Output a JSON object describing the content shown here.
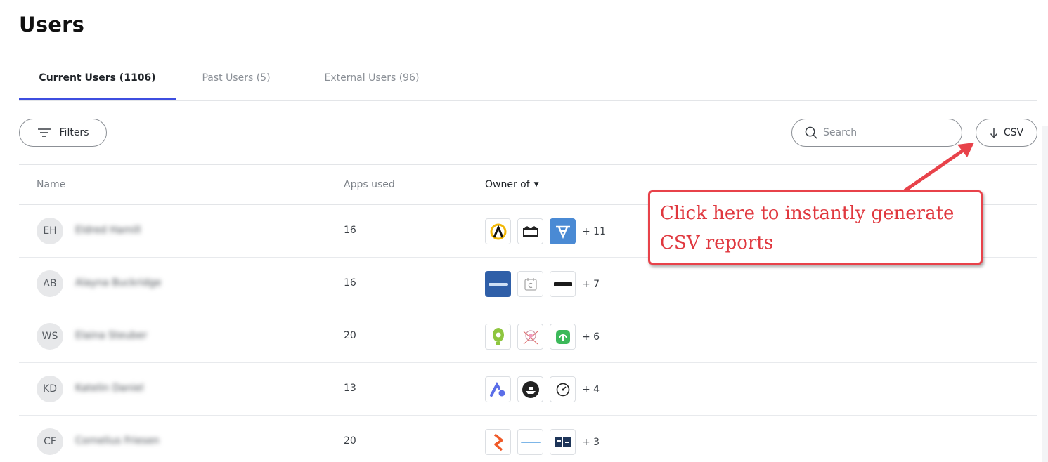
{
  "page": {
    "title": "Users"
  },
  "tabs": [
    {
      "label": "Current Users (1106)",
      "active": true
    },
    {
      "label": "Past Users (5)",
      "active": false
    },
    {
      "label": "External Users (96)",
      "active": false
    }
  ],
  "toolbar": {
    "filters_label": "Filters",
    "search_placeholder": "Search",
    "csv_label": "CSV"
  },
  "table": {
    "headers": {
      "name": "Name",
      "apps_used": "Apps used",
      "owner_of": "Owner of"
    },
    "rows": [
      {
        "initials": "EH",
        "name": "Eldred Hamill",
        "apps_used": "16",
        "owner_icons": [
          "archer-app-icon",
          "capsule-app-icon",
          "vector-app-icon"
        ],
        "more": "+ 11"
      },
      {
        "initials": "AB",
        "name": "Alayna Buckridge",
        "apps_used": "16",
        "owner_icons": [
          "anacrm-app-icon",
          "calendar-c-app-icon",
          "giftbit-app-icon"
        ],
        "more": "+ 7"
      },
      {
        "initials": "WS",
        "name": "Elaina Steuber",
        "apps_used": "20",
        "owner_icons": [
          "bulb-app-icon",
          "doodle-app-icon",
          "headset-app-icon"
        ],
        "more": "+ 6"
      },
      {
        "initials": "KD",
        "name": "Katelin Daniel",
        "apps_used": "13",
        "owner_icons": [
          "aurora-app-icon",
          "ship-app-icon",
          "dial-app-icon"
        ],
        "more": "+ 4"
      },
      {
        "initials": "CF",
        "name": "Cornelius Friesen",
        "apps_used": "20",
        "owner_icons": [
          "bolt-app-icon",
          "wordmark-app-icon",
          "fa-app-icon"
        ],
        "more": "+ 3"
      }
    ]
  },
  "annotation": {
    "line1": "Click here to instantly generate",
    "line2": "CSV reports",
    "color": "#e0383f"
  },
  "colors": {
    "accent": "#3d4ee0",
    "annotation_border": "#e8424a"
  }
}
